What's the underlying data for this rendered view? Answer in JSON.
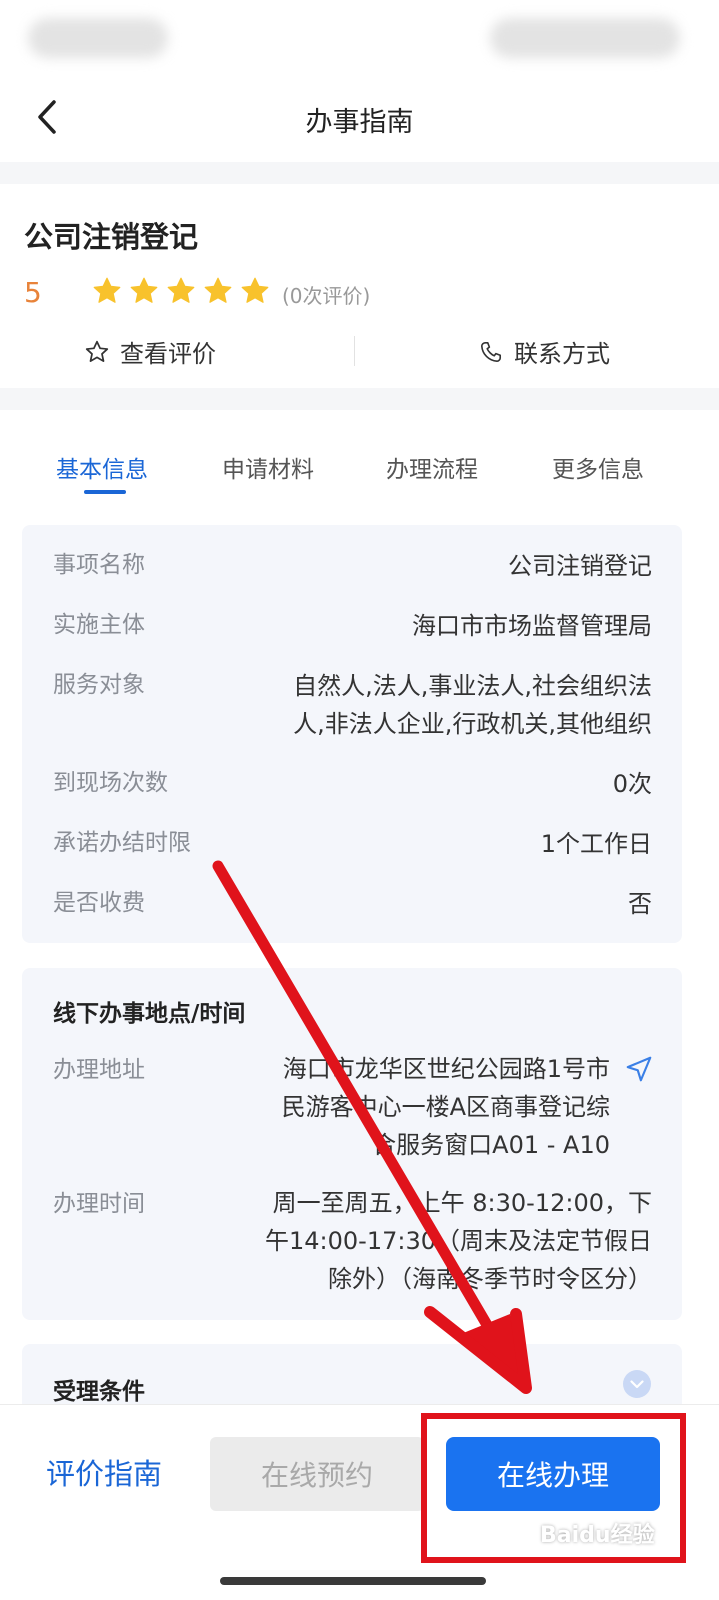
{
  "nav": {
    "title": "办事指南"
  },
  "summary": {
    "title": "公司注销登记",
    "rating_score": "5",
    "star_count": 5,
    "review_count_text": "(0次评价)",
    "view_reviews": "查看评价",
    "contact": "联系方式"
  },
  "tabs": [
    {
      "label": "基本信息",
      "active": true
    },
    {
      "label": "申请材料",
      "active": false
    },
    {
      "label": "办理流程",
      "active": false
    },
    {
      "label": "更多信息",
      "active": false
    }
  ],
  "basic_info": [
    {
      "label": "事项名称",
      "value": [
        "公司注销登记"
      ]
    },
    {
      "label": "实施主体",
      "value": [
        "海口市市场监督管理局"
      ]
    },
    {
      "label": "服务对象",
      "value": [
        "自然人,法人,事业法人,社会组织法",
        "人,非法人企业,行政机关,其他组织"
      ]
    },
    {
      "label": "到现场次数",
      "value": [
        "0次"
      ]
    },
    {
      "label": "承诺办结时限",
      "value": [
        "1个工作日"
      ]
    },
    {
      "label": "是否收费",
      "value": [
        "否"
      ]
    }
  ],
  "offline": {
    "heading": "线下办事地点/时间",
    "address_label": "办理地址",
    "address_lines": [
      "海口市龙华区世纪公园路1号市",
      "民游客中心一楼A区商事登记综",
      "合服务窗口A01 - A10"
    ],
    "time_label": "办理时间",
    "time_lines": [
      "周一至周五，上午 8:30-12:00，下",
      "午14:00-17:30（周末及法定节假日",
      "除外）（海南冬季节时令区分）"
    ]
  },
  "conditions": {
    "heading": "受理条件"
  },
  "bottom_bar": {
    "rate_guide": "评价指南",
    "reserve_online": "在线预约",
    "handle_online": "在线办理"
  },
  "watermark": "Baidu经验",
  "colors": {
    "accent": "#1a66d6",
    "primary_button": "#1a73f0",
    "rating": "#e8833a",
    "star": "#f8c22c",
    "annotation_red": "#e0131b"
  }
}
